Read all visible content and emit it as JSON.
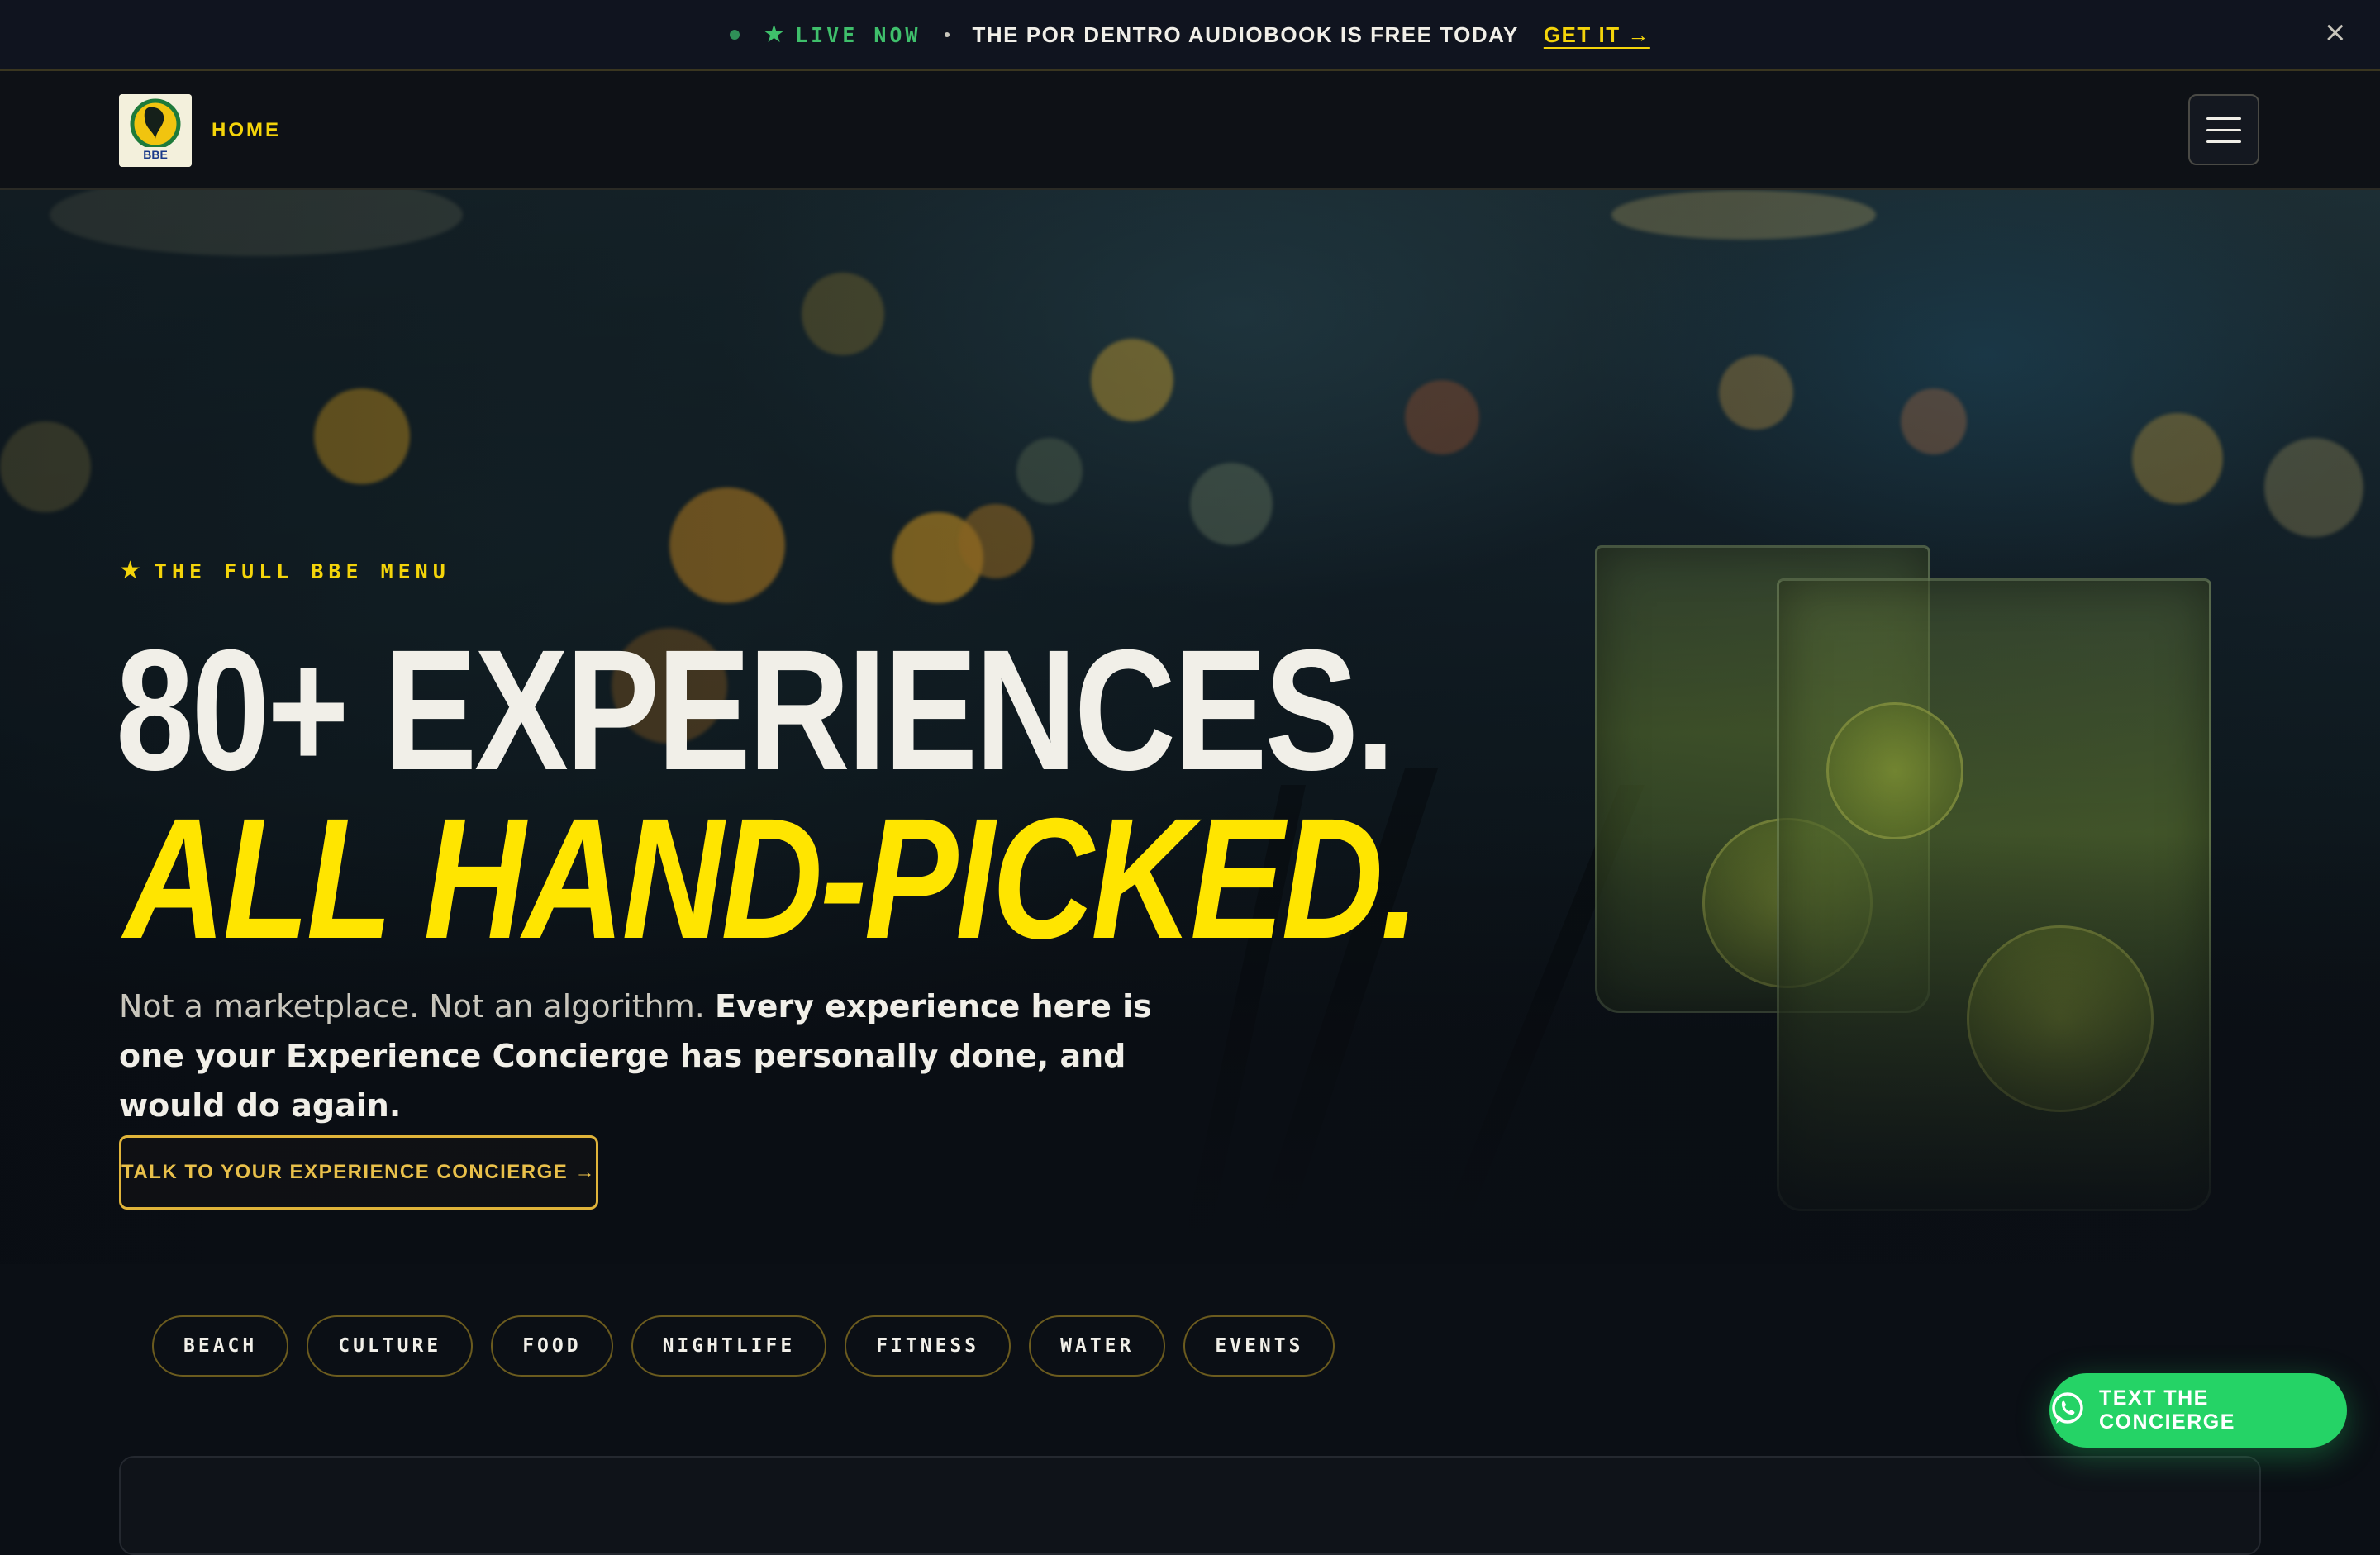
{
  "announcement": {
    "live_label": "LIVE NOW",
    "message": "THE POR DENTRO AUDIOBOOK IS FREE TODAY",
    "link_label": "GET IT →",
    "close_label": "×",
    "star_icon": "star-icon",
    "colors": {
      "live": "#3fbf6b",
      "link": "#f4d40a"
    }
  },
  "header": {
    "logo_text": "BBE",
    "home_label": "HOME",
    "menu_icon": "hamburger-icon"
  },
  "hero": {
    "eyebrow": "THE FULL BBE MENU",
    "headline_line1": "80+ EXPERIENCES.",
    "headline_line2": "ALL HAND-PICKED.",
    "subcopy_plain": "Not a marketplace. Not an algorithm. ",
    "subcopy_strong": "Every experience here is one your Experience Concierge has personally done, and would do again.",
    "cta_label": "TALK TO YOUR EXPERIENCE CONCIERGE →",
    "colors": {
      "accent": "#ffe500",
      "text": "#f1efe8"
    }
  },
  "categories": [
    "BEACH",
    "CULTURE",
    "FOOD",
    "NIGHTLIFE",
    "FITNESS",
    "WATER",
    "EVENTS"
  ],
  "floating_button": {
    "label": "TEXT THE CONCIERGE",
    "icon": "whatsapp-icon",
    "color": "#25d366"
  }
}
